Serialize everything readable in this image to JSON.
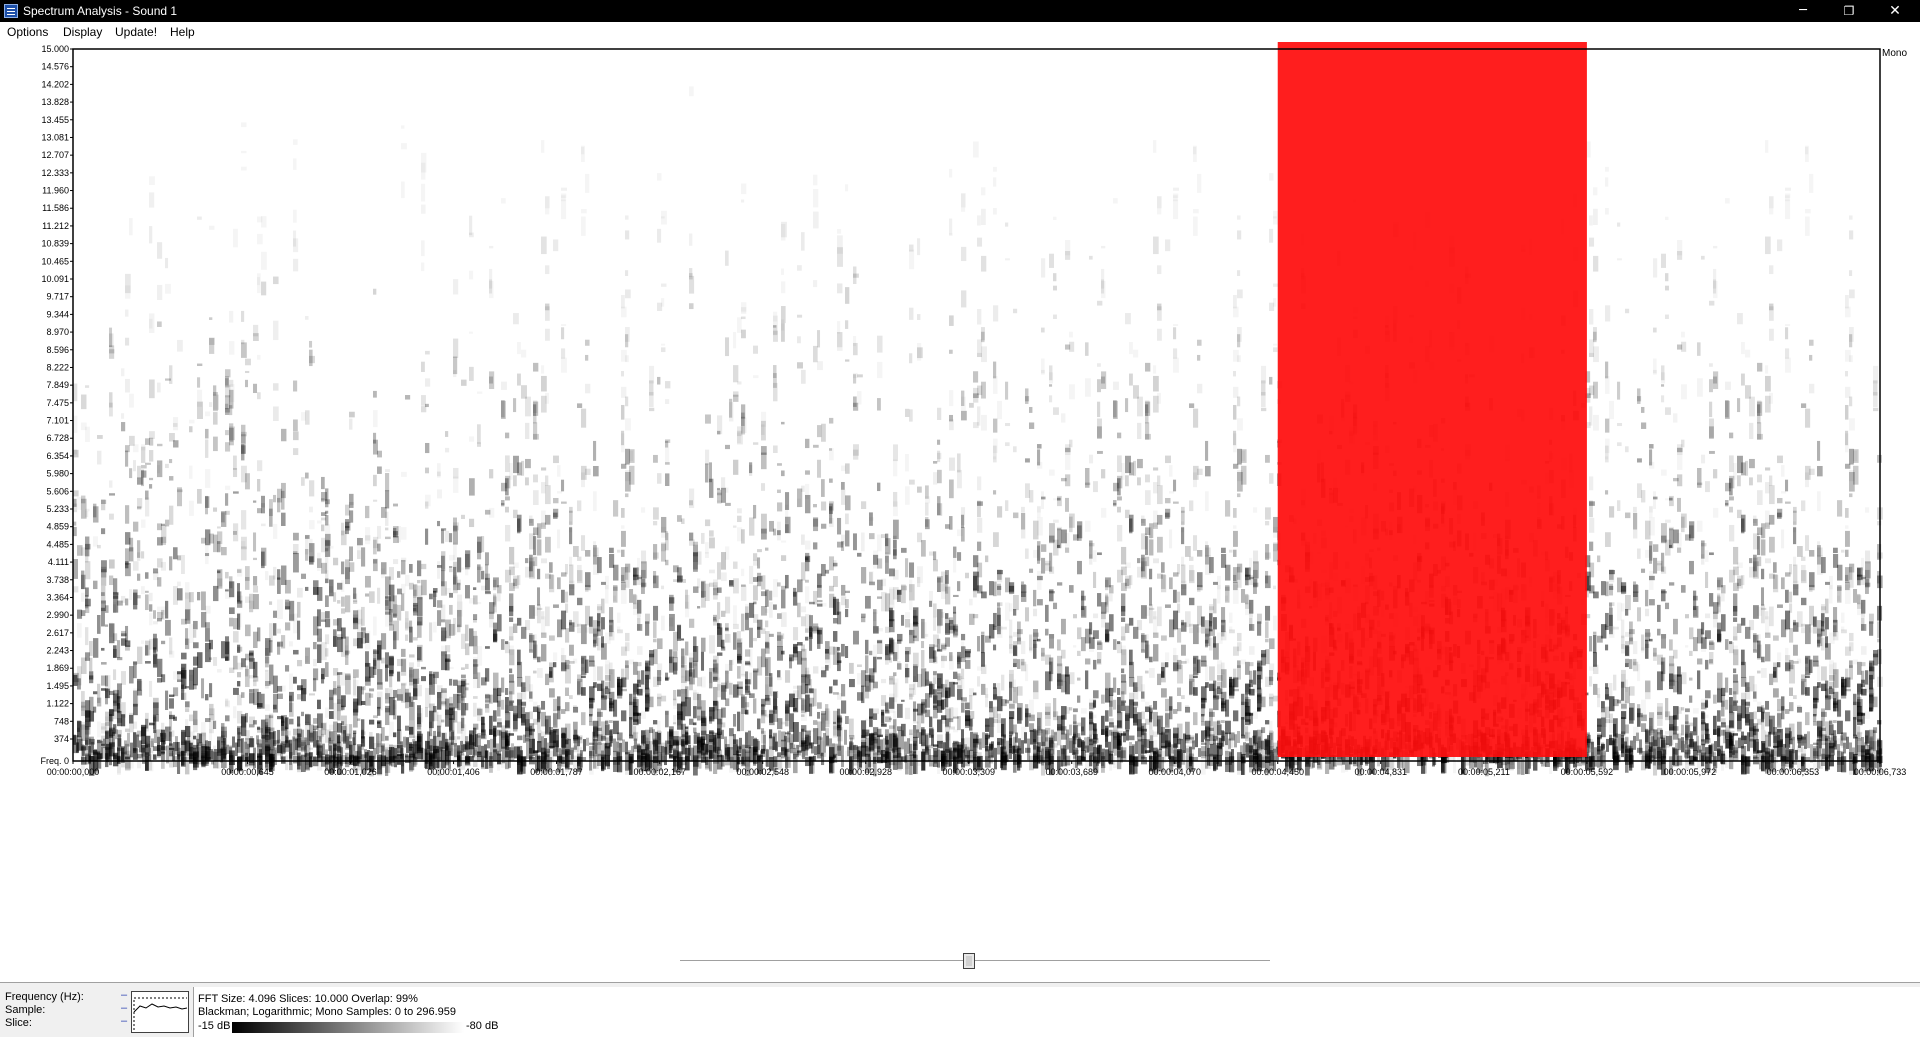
{
  "window": {
    "title": "Spectrum Analysis - Sound 1",
    "minimize_glyph": "─",
    "restore_glyph": "❐",
    "close_glyph": "✕"
  },
  "menu": {
    "items": [
      "Options",
      "Display",
      "Update!",
      "Help"
    ]
  },
  "spectrogram": {
    "channel": "Mono",
    "freq_axis_title": "Freq. 0",
    "freq_labels": [
      "15.000",
      "14.576",
      "14.202",
      "13.828",
      "13.455",
      "13.081",
      "12.707",
      "12.333",
      "11.960",
      "11.586",
      "11.212",
      "10.839",
      "10.465",
      "10.091",
      "9.717",
      "9.344",
      "8.970",
      "8.596",
      "8.222",
      "7.849",
      "7.475",
      "7.101",
      "6.728",
      "6.354",
      "5.980",
      "5.606",
      "5.233",
      "4.859",
      "4.485",
      "4.111",
      "3.738",
      "3.364",
      "2.990",
      "2.617",
      "2.243",
      "1.869",
      "1.495",
      "1.122",
      "748",
      "374"
    ],
    "time_labels": [
      "00:00:00,000",
      "00:00:00,645",
      "00:00:01,026",
      "00:00:01,406",
      "00:00:01,787",
      "00:00:02,167",
      "00:00:02,548",
      "00:00:02,928",
      "00:00:03,309",
      "00:00:03,689",
      "00:00:04,070",
      "00:00:04,450",
      "00:00:04,831",
      "00:00:05,211",
      "00:00:05,592",
      "00:00:05,972",
      "00:00:06,353",
      "00:00:06,733"
    ],
    "time_tick_fractions": [
      0.0,
      0.0966,
      0.1536,
      0.2106,
      0.2676,
      0.3247,
      0.3817,
      0.4387,
      0.4957,
      0.5527,
      0.6097,
      0.6667,
      0.7237,
      0.7808,
      0.8378,
      0.8948,
      0.9518,
      1.0
    ],
    "selection": {
      "start_time": "00:00:04,450",
      "end_time": "00:00:05,592",
      "color": "#ff0d0d"
    },
    "spectrum_color": "#000000",
    "background_color": "#ffffff"
  },
  "scroll": {
    "position_fraction": 0.49
  },
  "status": {
    "frequency_label": "Frequency (Hz):",
    "sample_label": "Sample:",
    "slice_label": "Slice:",
    "dash": "–",
    "info_line1": "FFT Size: 4.096  Slices: 10.000  Overlap: 99%",
    "info_line2": "Blackman; Logarithmic; Mono  Samples: 0 to 296.959",
    "db_min": "-15 dB",
    "db_max": "-80 dB"
  }
}
